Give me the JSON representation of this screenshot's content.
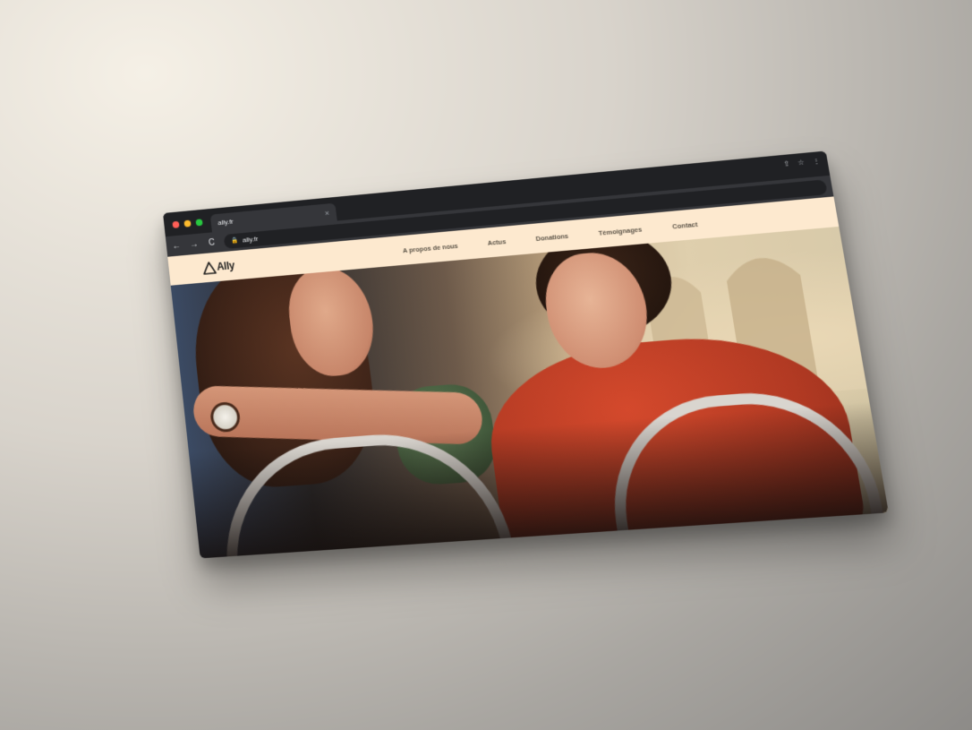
{
  "browser": {
    "tab_title": "ally.fr",
    "tab_close": "×",
    "url": "ally.fr",
    "nav_back": "←",
    "nav_forward": "→",
    "nav_reload": "C",
    "icons": [
      "share-icon",
      "star-icon",
      "menu-kebab-icon"
    ]
  },
  "site": {
    "brand": "Ally",
    "menu": [
      {
        "label": "A propos de nous"
      },
      {
        "label": "Actus"
      },
      {
        "label": "Donations"
      },
      {
        "label": "Témoignages"
      },
      {
        "label": "Contact"
      }
    ],
    "colors": {
      "header_bg": "#fde9cf",
      "menu_text": "#5b5347"
    }
  }
}
